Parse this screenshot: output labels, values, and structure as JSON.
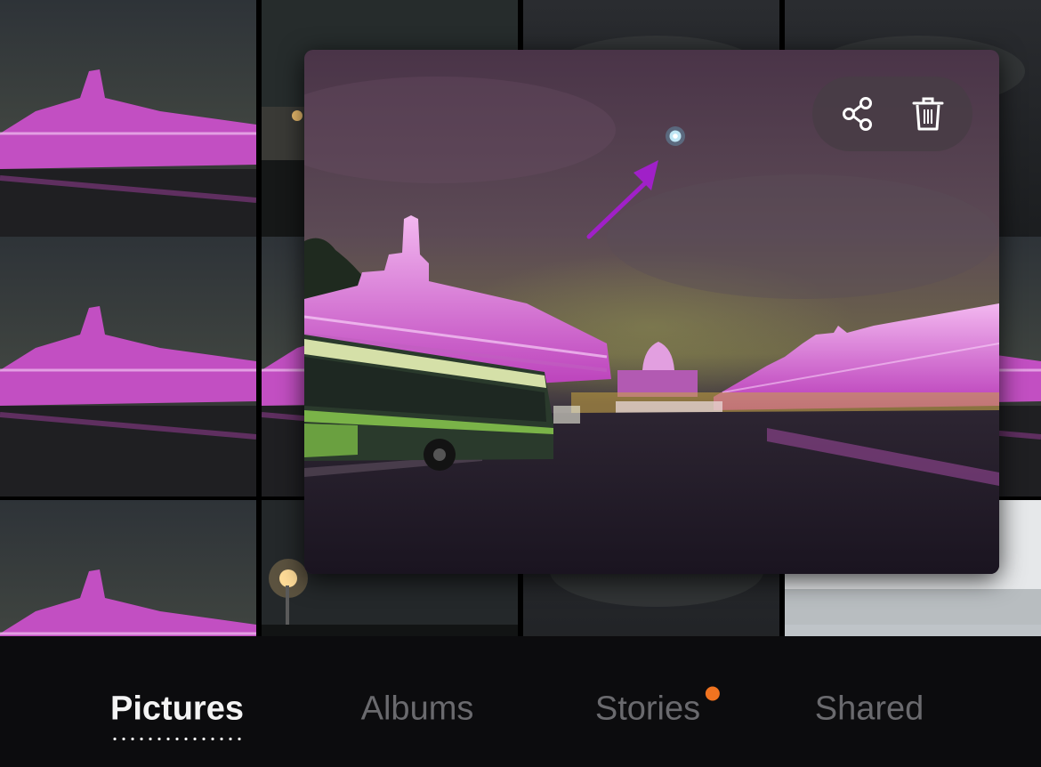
{
  "gallery": {
    "thumbnails": [
      {
        "id": "thumb-1",
        "subject": "palace-night"
      },
      {
        "id": "thumb-2",
        "subject": "city-night"
      },
      {
        "id": "thumb-3",
        "subject": "night-sky"
      },
      {
        "id": "thumb-4",
        "subject": "night-sky"
      },
      {
        "id": "thumb-5",
        "subject": "palace-night"
      },
      {
        "id": "thumb-6",
        "subject": "palace-night"
      },
      {
        "id": "thumb-7",
        "subject": "night-sky"
      },
      {
        "id": "thumb-8",
        "subject": "palace-night"
      },
      {
        "id": "thumb-9",
        "subject": "palace-night"
      },
      {
        "id": "thumb-10",
        "subject": "street-lamp"
      },
      {
        "id": "thumb-11",
        "subject": "night-sky"
      },
      {
        "id": "thumb-12",
        "subject": "overexposed"
      }
    ]
  },
  "preview": {
    "actions": {
      "share_icon": "share-icon",
      "delete_icon": "trash-icon"
    },
    "annotation_color": "#a020c8"
  },
  "bottom_nav": {
    "tabs": [
      {
        "label": "Pictures",
        "active": true,
        "badge": false
      },
      {
        "label": "Albums",
        "active": false,
        "badge": false
      },
      {
        "label": "Stories",
        "active": false,
        "badge": true
      },
      {
        "label": "Shared",
        "active": false,
        "badge": false
      }
    ],
    "active_color": "#f4f4f4",
    "inactive_color": "#6a6a6e",
    "badge_color": "#f07320"
  }
}
